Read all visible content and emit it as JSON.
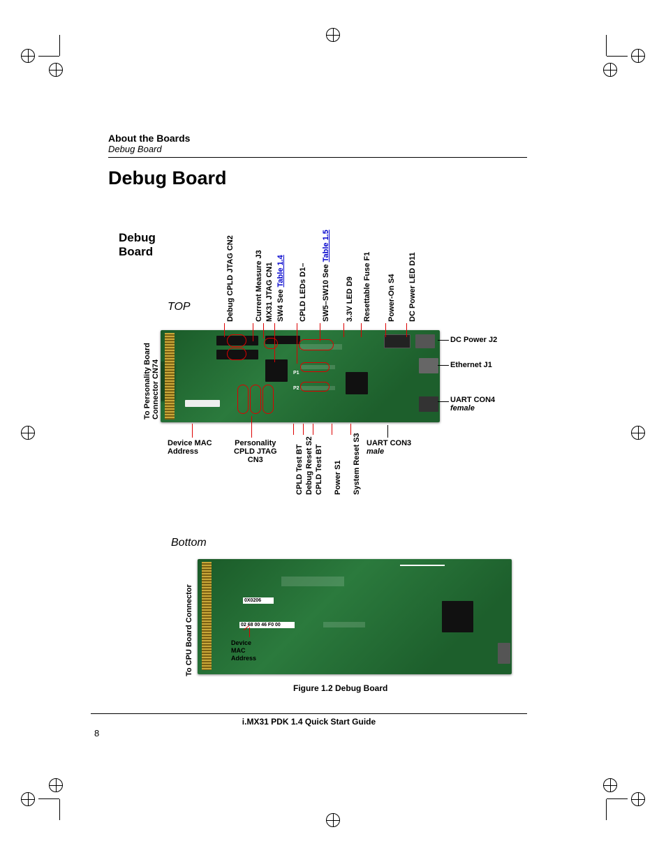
{
  "header": {
    "section": "About the Boards",
    "subsection": "Debug Board"
  },
  "heading": "Debug Board",
  "figure": {
    "title_bold": "Debug",
    "title_bold2": "Board",
    "top_label": "TOP",
    "bottom_label": "Bottom",
    "left_vertical_top": "To Personality Board\nConnector CN74",
    "left_vertical_bottom": "To CPU Board Connector",
    "top_labels": {
      "debug_cpld_jtag": "Debug CPLD JTAG CN2",
      "current_measure": "Current Measure J3",
      "mx31_jtag": "MX31 JTAG CN1",
      "sw4_see": "SW4 See ",
      "sw4_link": "Table 1.4",
      "cpld_leds": "CPLD LEDs D1–",
      "sw5_sw10": "SW5–SW10 See ",
      "sw5_link": "Table 1.5",
      "led_3v3": "3.3V LED D9",
      "fuse": "Resettable Fuse F1",
      "power_on": "Power-On S4",
      "dc_power_led": "DC Power LED D11"
    },
    "right_labels": {
      "dc_power": "DC Power J2",
      "ethernet": "Ethernet J1",
      "uart_con4": "UART CON4",
      "uart_con4_sub": "female"
    },
    "bottom_labels": {
      "device_mac": "Device MAC\nAddress",
      "personality": "Personality\nCPLD JTAG\nCN3",
      "cpld_test_bt1": "CPLD Test BT",
      "debug_reset": "Debug Reset S2",
      "cpld_test_bt2": "CPLD Test BT",
      "power_s1": "Power S1",
      "system_reset": "System Reset S3",
      "uart_con3": "UART CON3",
      "uart_con3_sub": "male"
    },
    "on_board": {
      "p1": "P1",
      "p2": "P2"
    },
    "bottom_board": {
      "device_mac": "Device\nMAC\nAddress"
    },
    "caption": "Figure 1.2  Debug Board"
  },
  "footer": "i.MX31 PDK 1.4 Quick Start Guide",
  "page_number": "8"
}
